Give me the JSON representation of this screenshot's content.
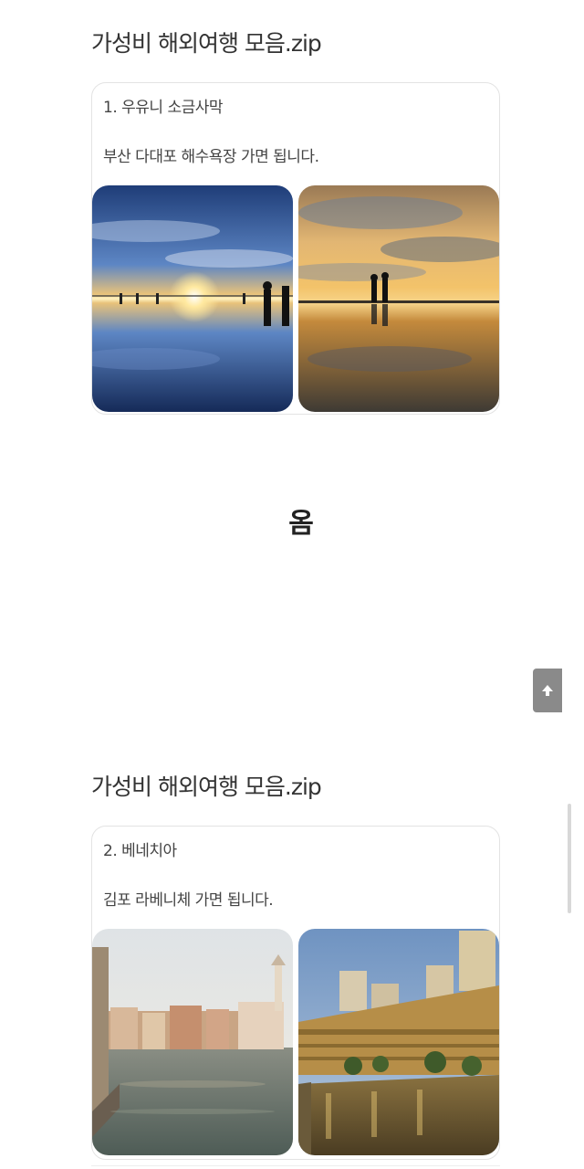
{
  "posts": [
    {
      "title": "가성비 해외여행 모음.zip",
      "heading": "1. 우유니 소금사막",
      "body": "부산 다대포 해수욕장 가면 됩니다."
    },
    {
      "title": "가성비 해외여행 모음.zip",
      "heading": "2. 베네치아",
      "body": "김포 라베니체 가면 됩니다."
    }
  ],
  "interjection": "옴",
  "icons": {
    "scroll_top": "arrow-up-icon"
  },
  "colors": {
    "text": "#333333",
    "card_border": "#e3e3e3",
    "scroll_button": "#8a8a8a"
  }
}
